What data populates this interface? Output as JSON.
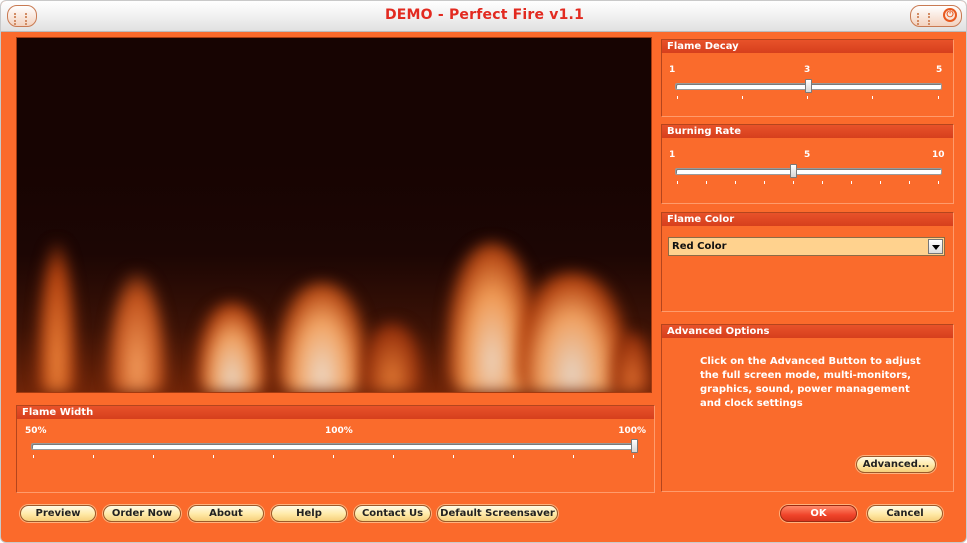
{
  "window": {
    "title": "DEMO - Perfect Fire v1.1"
  },
  "flame_decay": {
    "header": "Flame Decay",
    "min_label": "1",
    "mid_label": "3",
    "max_label": "5",
    "value": 3,
    "min": 1,
    "max": 5
  },
  "burning_rate": {
    "header": "Burning Rate",
    "min_label": "1",
    "mid_label": "5",
    "max_label": "10",
    "value": 5,
    "min": 1,
    "max": 10
  },
  "flame_color": {
    "header": "Flame Color",
    "selected": "Red Color"
  },
  "advanced_options": {
    "header": "Advanced Options",
    "description": "Click on the Advanced Button to adjust the full screen mode, multi-monitors, graphics, sound, power management and clock settings",
    "button_label": "Advanced..."
  },
  "flame_width": {
    "header": "Flame Width",
    "min_label": "50%",
    "mid_label": "100%",
    "max_label": "100%",
    "value_fraction": 1.0
  },
  "buttons": {
    "preview": "Preview",
    "order_now": "Order Now",
    "about": "About",
    "help": "Help",
    "contact_us": "Contact Us",
    "default_screensaver": "Default Screensaver",
    "ok": "OK",
    "cancel": "Cancel"
  },
  "icons": {
    "power": "power-icon"
  },
  "colors": {
    "accent": "#fb6a2b",
    "panel_header": "#e04a25",
    "title_text": "#e22a20",
    "button_fill": "#ffe9a6"
  }
}
